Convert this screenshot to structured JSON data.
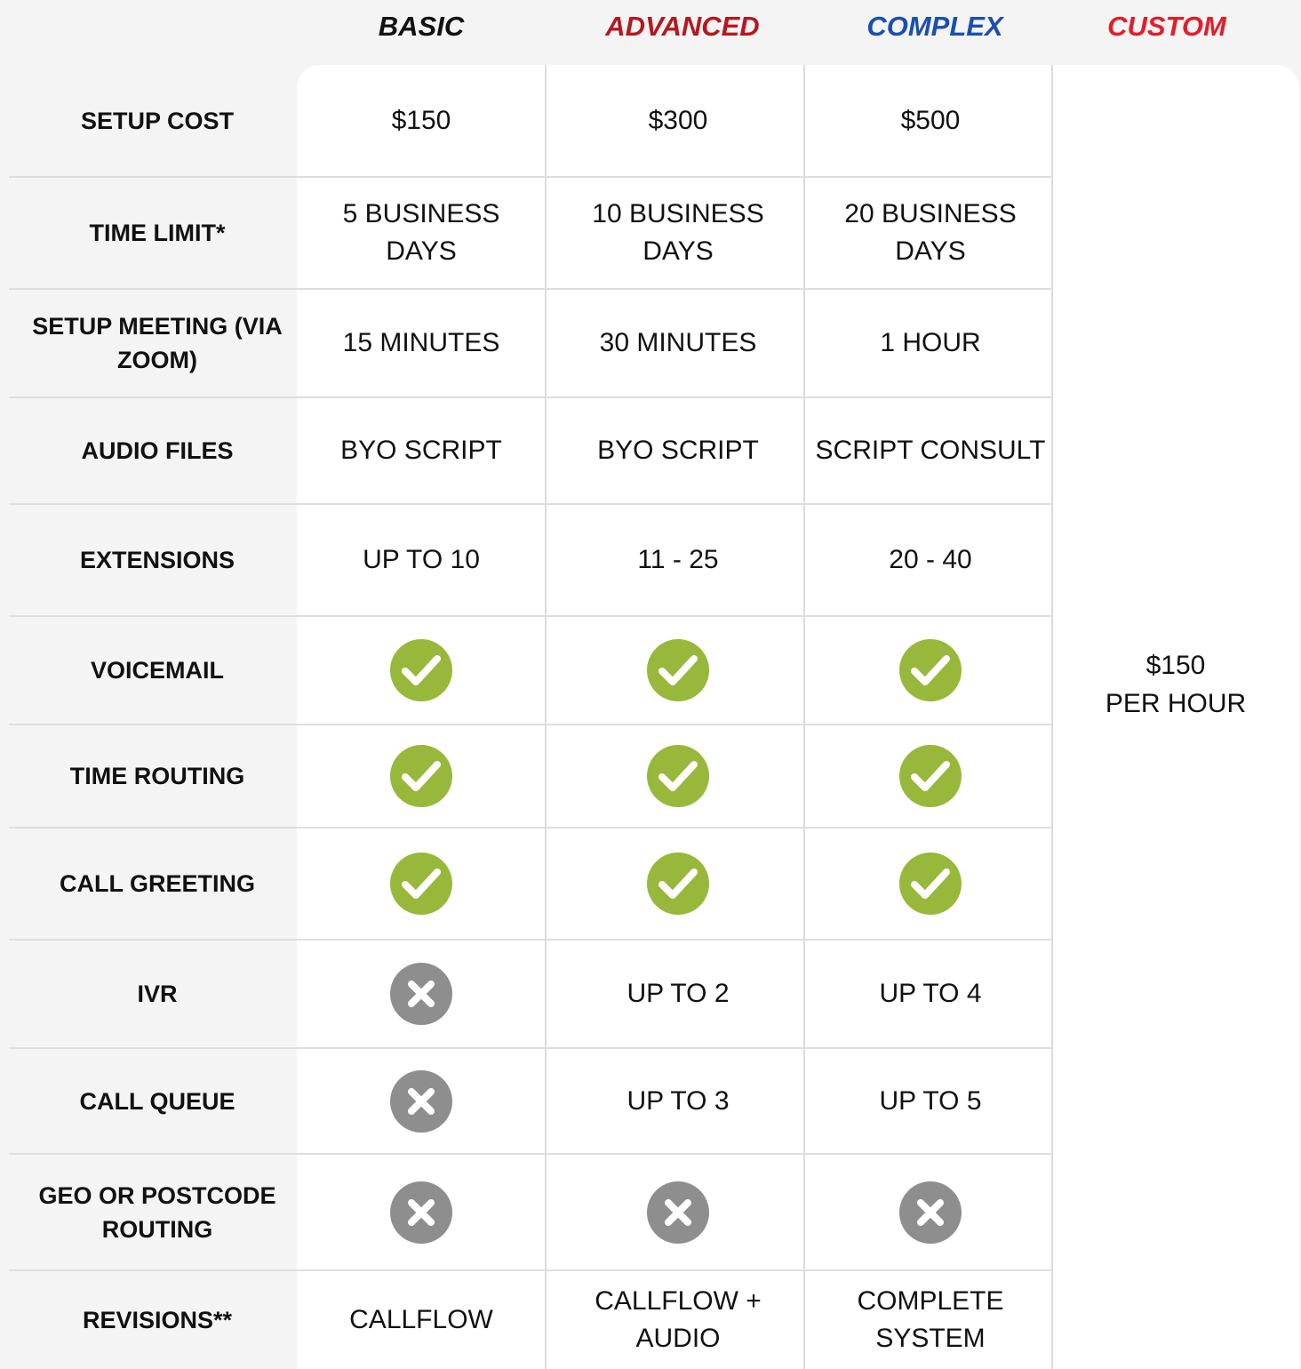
{
  "tiers": [
    {
      "name": "BASIC",
      "color": "#111111"
    },
    {
      "name": "ADVANCED",
      "color": "#b5181f"
    },
    {
      "name": "COMPLEX",
      "color": "#1a4fae"
    },
    {
      "name": "CUSTOM",
      "color": "#e01f2a"
    }
  ],
  "rows": [
    {
      "label": "SETUP COST",
      "cells": [
        {
          "text": "$150"
        },
        {
          "text": "$300"
        },
        {
          "text": "$500"
        }
      ]
    },
    {
      "label": "TIME LIMIT*",
      "cells": [
        {
          "text": "5 BUSINESS DAYS"
        },
        {
          "text": "10 BUSINESS DAYS"
        },
        {
          "text": "20 BUSINESS DAYS"
        }
      ]
    },
    {
      "label": "SETUP MEETING (VIA ZOOM)",
      "cells": [
        {
          "text": "15 MINUTES"
        },
        {
          "text": "30 MINUTES"
        },
        {
          "text": "1 HOUR"
        }
      ]
    },
    {
      "label": "AUDIO FILES",
      "cells": [
        {
          "text": "BYO SCRIPT"
        },
        {
          "text": "BYO SCRIPT"
        },
        {
          "text": "SCRIPT CONSULT"
        }
      ]
    },
    {
      "label": "EXTENSIONS",
      "cells": [
        {
          "text": "UP TO 10"
        },
        {
          "text": "11 - 25"
        },
        {
          "text": "20 - 40"
        }
      ]
    },
    {
      "label": "VOICEMAIL",
      "cells": [
        {
          "icon": "check-icon"
        },
        {
          "icon": "check-icon"
        },
        {
          "icon": "check-icon"
        }
      ]
    },
    {
      "label": "TIME ROUTING",
      "cells": [
        {
          "icon": "check-icon"
        },
        {
          "icon": "check-icon"
        },
        {
          "icon": "check-icon"
        }
      ]
    },
    {
      "label": "CALL GREETING",
      "cells": [
        {
          "icon": "check-icon"
        },
        {
          "icon": "check-icon"
        },
        {
          "icon": "check-icon"
        }
      ]
    },
    {
      "label": "IVR",
      "cells": [
        {
          "icon": "cross-icon"
        },
        {
          "text": "UP TO 2"
        },
        {
          "text": "UP TO 4"
        }
      ]
    },
    {
      "label": "CALL QUEUE",
      "cells": [
        {
          "icon": "cross-icon"
        },
        {
          "text": "UP TO 3"
        },
        {
          "text": "UP TO 5"
        }
      ]
    },
    {
      "label": "GEO OR POSTCODE ROUTING",
      "cells": [
        {
          "icon": "cross-icon"
        },
        {
          "icon": "cross-icon"
        },
        {
          "icon": "cross-icon"
        }
      ]
    },
    {
      "label": "REVISIONS**",
      "cells": [
        {
          "text": "CALLFLOW"
        },
        {
          "text": "CALLFLOW + AUDIO"
        },
        {
          "text": "COMPLETE SYSTEM"
        }
      ]
    }
  ],
  "custom": {
    "price": "$150",
    "unit": "PER HOUR"
  },
  "colors": {
    "check": "#98b83c",
    "cross": "#8e8e8e"
  }
}
